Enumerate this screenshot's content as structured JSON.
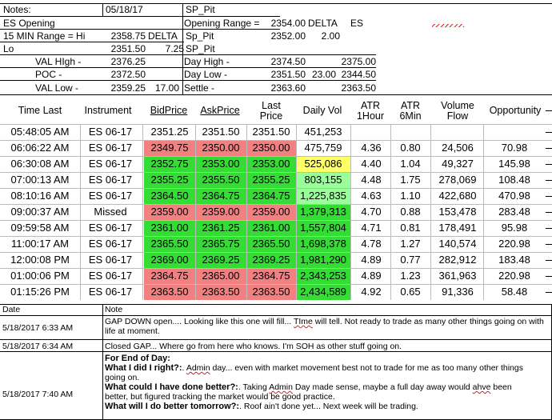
{
  "top": {
    "notes_label": "Notes:",
    "date": "05/18/17",
    "pit_label": "SP_Pit",
    "es_opening": "ES Opening",
    "min15": "15 MIN Range = Hi",
    "min15_val": "2358.75",
    "delta1": "DELTA",
    "sp_pit_a": "Sp_Pit",
    "lo": "Lo",
    "lo_val": "2351.50",
    "lo_delta": "7.25",
    "sp_pit_b": "SP_Pit",
    "opening_range": "Opening Range =",
    "opening_range_val": "2354.00",
    "delta2": "DELTA",
    "es": "ES",
    "sp_pit_val": "2352.00",
    "sp_pit_delta": "2.00",
    "val_high": "VAL HIgh   -",
    "val_high_val": "2376.25",
    "poc": "POC     -",
    "poc_val": "2372.50",
    "val_low": "VAL Low    -",
    "val_low_val": "2359.25",
    "val_low_delta": "17.00",
    "day_high": "Day High -",
    "day_high_val": "2374.50",
    "day_high_es": "2375.00",
    "day_low": "Day Low -",
    "day_low_val": "2351.50",
    "day_low_delta": "23.00",
    "day_low_es": "2344.50",
    "settle": "Settle -",
    "settle_val": "2363.60",
    "settle_es": "2363.50"
  },
  "grid": {
    "headers": {
      "time": "Time Last",
      "instrument": "Instrument",
      "bid": "BidPrice",
      "ask": "AskPrice",
      "last1": "Last",
      "last2": "Price",
      "vol": "Daily Vol",
      "atr1a": "ATR",
      "atr1b": "1Hour",
      "atr6a": "ATR",
      "atr6b": "6Min",
      "vf1": "Volume",
      "vf2": "Flow",
      "opp": "Opportunity"
    },
    "colors": {
      "red": "#f28080",
      "green": "#33dd33",
      "yellow": "#ffff66",
      "light_green": "#99ff99"
    },
    "rows": [
      {
        "time": "05:48:05 AM",
        "inst": "ES 06-17",
        "bid": "2351.25",
        "ask": "2351.50",
        "last": "2351.50",
        "vol": "451,253",
        "atr1": "",
        "atr6": "",
        "vf": "",
        "opp": "",
        "pc": "",
        "vc": ""
      },
      {
        "time": "06:06:22 AM",
        "inst": "ES 06-17",
        "bid": "2349.75",
        "ask": "2350.00",
        "last": "2350.00",
        "vol": "475,759",
        "atr1": "4.36",
        "atr6": "0.80",
        "vf": "24,506",
        "opp": "70.98",
        "pc": "red",
        "vc": ""
      },
      {
        "time": "06:30:08 AM",
        "inst": "ES 06-17",
        "bid": "2352.75",
        "ask": "2353.00",
        "last": "2353.00",
        "vol": "525,086",
        "atr1": "4.40",
        "atr6": "1.04",
        "vf": "49,327",
        "opp": "145.98",
        "pc": "green",
        "vc": "yellow"
      },
      {
        "time": "07:00:13 AM",
        "inst": "ES 06-17",
        "bid": "2355.25",
        "ask": "2355.50",
        "last": "2355.25",
        "vol": "803,155",
        "atr1": "4.48",
        "atr6": "1.75",
        "vf": "278,069",
        "opp": "108.48",
        "pc": "green",
        "vc": "light_green"
      },
      {
        "time": "08:10:16 AM",
        "inst": "ES 06-17",
        "bid": "2364.50",
        "ask": "2364.75",
        "last": "2364.75",
        "vol": "1,225,835",
        "atr1": "4.63",
        "atr6": "1.10",
        "vf": "422,680",
        "opp": "470.98",
        "pc": "green",
        "vc": "light_green"
      },
      {
        "time": "09:00:37 AM",
        "inst": "Missed",
        "bid": "2359.00",
        "ask": "2359.00",
        "last": "2359.00",
        "vol": "1,379,313",
        "atr1": "4.70",
        "atr6": "0.88",
        "vf": "153,478",
        "opp": "283.48",
        "pc": "red",
        "vc": "green"
      },
      {
        "time": "09:59:58 AM",
        "inst": "ES 06-17",
        "bid": "2361.00",
        "ask": "2361.25",
        "last": "2361.00",
        "vol": "1,557,804",
        "atr1": "4.71",
        "atr6": "0.81",
        "vf": "178,491",
        "opp": "95.98",
        "pc": "green",
        "vc": "green"
      },
      {
        "time": "11:00:17 AM",
        "inst": "ES 06-17",
        "bid": "2365.50",
        "ask": "2365.75",
        "last": "2365.50",
        "vol": "1,698,378",
        "atr1": "4.78",
        "atr6": "1.27",
        "vf": "140,574",
        "opp": "220.98",
        "pc": "green",
        "vc": "green"
      },
      {
        "time": "12:00:08 PM",
        "inst": "ES 06-17",
        "bid": "2369.00",
        "ask": "2369.25",
        "last": "2369.25",
        "vol": "1,981,290",
        "atr1": "4.89",
        "atr6": "0.77",
        "vf": "282,912",
        "opp": "183.48",
        "pc": "green",
        "vc": "green"
      },
      {
        "time": "01:00:06 PM",
        "inst": "ES 06-17",
        "bid": "2364.75",
        "ask": "2365.00",
        "last": "2364.75",
        "vol": "2,343,253",
        "atr1": "4.89",
        "atr6": "1.23",
        "vf": "361,963",
        "opp": "220.98",
        "pc": "red",
        "vc": "green"
      },
      {
        "time": "01:15:26 PM",
        "inst": "ES 06-17",
        "bid": "2363.50",
        "ask": "2363.50",
        "last": "2363.50",
        "vol": "2,434,589",
        "atr1": "4.92",
        "atr6": "0.65",
        "vf": "91,336",
        "opp": "58.48",
        "pc": "red",
        "vc": "green"
      }
    ]
  },
  "notes": {
    "col_date": "Date",
    "col_note": "Note",
    "n1_date": "5/18/2017 6:33 AM",
    "n1_a": "GAP DOWN open.... Looking like this one will fill... ",
    "n1_time": "TIme",
    "n1_b": " will tell.  Not ready to trade as many other things going on with",
    "n1_c": "life at moment.",
    "n2_date": "5/18/2017 6:34 AM",
    "n2": "Closed GAP... Where go from here who knows.  I'm SOH as other stuff going on.",
    "n3_date": "5/18/2017 7:40 AM",
    "n3_head": "For End of Day:",
    "q1": "What I did I right?:",
    "q1_a": ".  ",
    "q1_admin": "Admin",
    "q1_b": " day... even with market movement best not to trade for me as too many other things",
    "q1_c": "going on.",
    "q2": "What could I have done better?:",
    "q2_a": ".  Taking ",
    "q2_admin": "Admin",
    "q2_b": " Day made sense, maybe a full day away would ",
    "q2_ahve": "ahve",
    "q2_c": " been",
    "q2_d": "better, but figured tracking the market would be good practice.",
    "q3": "What will I do better tomorrow?:",
    "q3_a": ".  Roof ain't done yet... Next week will be trading."
  }
}
